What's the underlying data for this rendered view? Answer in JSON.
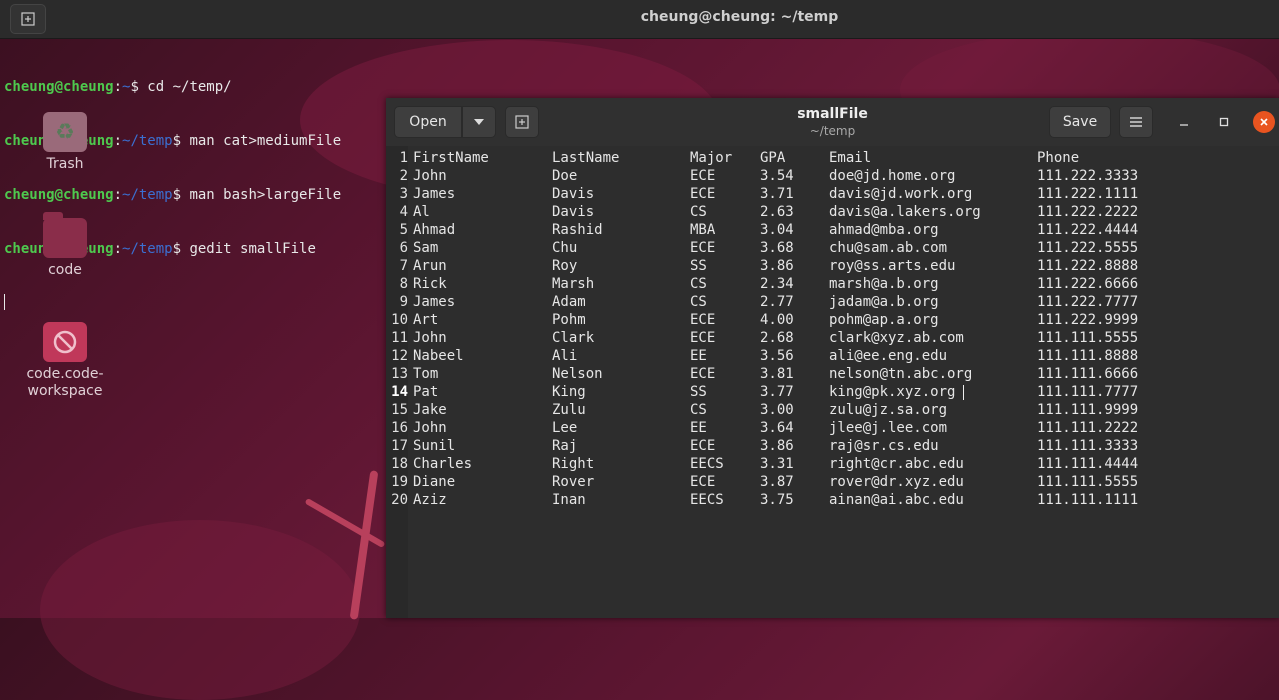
{
  "terminal": {
    "title": "cheung@cheung: ~/temp",
    "lines": [
      {
        "user": "cheung@cheung",
        "sep": ":",
        "path": "~",
        "cmd": "$ cd ~/temp/"
      },
      {
        "user": "cheung@cheung",
        "sep": ":",
        "path": "~/temp",
        "cmd": "$ man cat>mediumFile"
      },
      {
        "user": "cheung@cheung",
        "sep": ":",
        "path": "~/temp",
        "cmd": "$ man bash>largeFile"
      },
      {
        "user": "cheung@cheung",
        "sep": ":",
        "path": "~/temp",
        "cmd": "$ gedit smallFile"
      }
    ]
  },
  "desktop": {
    "icons": [
      {
        "label": "Trash",
        "icon": "trash-icon"
      },
      {
        "label": "code",
        "icon": "folder-icon"
      },
      {
        "label": "code.code-workspace",
        "icon": "blocked-file-icon"
      }
    ]
  },
  "gedit": {
    "open_label": "Open",
    "save_label": "Save",
    "title": "smallFile",
    "subtitle": "~/temp",
    "current_line": 14,
    "rows": [
      [
        "1",
        "FirstName",
        "LastName",
        "Major",
        "GPA",
        "Email",
        "Phone"
      ],
      [
        "2",
        "John",
        "Doe",
        "ECE",
        "3.54",
        "doe@jd.home.org",
        "111.222.3333"
      ],
      [
        "3",
        "James",
        "Davis",
        "ECE",
        "3.71",
        "davis@jd.work.org",
        "111.222.1111"
      ],
      [
        "4",
        "Al",
        "Davis",
        "CS",
        "2.63",
        "davis@a.lakers.org",
        "111.222.2222"
      ],
      [
        "5",
        "Ahmad",
        "Rashid",
        "MBA",
        "3.04",
        "ahmad@mba.org",
        "111.222.4444"
      ],
      [
        "6",
        "Sam",
        "Chu",
        "ECE",
        "3.68",
        "chu@sam.ab.com",
        "111.222.5555"
      ],
      [
        "7",
        "Arun",
        "Roy",
        "SS",
        "3.86",
        "roy@ss.arts.edu",
        "111.222.8888"
      ],
      [
        "8",
        "Rick",
        "Marsh",
        "CS",
        "2.34",
        "marsh@a.b.org",
        "111.222.6666"
      ],
      [
        "9",
        "James",
        "Adam",
        "CS",
        "2.77",
        "jadam@a.b.org",
        "111.222.7777"
      ],
      [
        "10",
        "Art",
        "Pohm",
        "ECE",
        "4.00",
        "pohm@ap.a.org",
        "111.222.9999"
      ],
      [
        "11",
        "John",
        "Clark",
        "ECE",
        "2.68",
        "clark@xyz.ab.com",
        "111.111.5555"
      ],
      [
        "12",
        "Nabeel",
        "Ali",
        "EE",
        "3.56",
        "ali@ee.eng.edu",
        "111.111.8888"
      ],
      [
        "13",
        "Tom",
        "Nelson",
        "ECE",
        "3.81",
        "nelson@tn.abc.org",
        "111.111.6666"
      ],
      [
        "14",
        "Pat",
        "King",
        "SS",
        "3.77",
        "king@pk.xyz.org",
        "111.111.7777"
      ],
      [
        "15",
        "Jake",
        "Zulu",
        "CS",
        "3.00",
        "zulu@jz.sa.org",
        "111.111.9999"
      ],
      [
        "16",
        "John",
        "Lee",
        "EE",
        "3.64",
        "jlee@j.lee.com",
        "111.111.2222"
      ],
      [
        "17",
        "Sunil",
        "Raj",
        "ECE",
        "3.86",
        "raj@sr.cs.edu",
        "111.111.3333"
      ],
      [
        "18",
        "Charles",
        "Right",
        "EECS",
        "3.31",
        "right@cr.abc.edu",
        "111.111.4444"
      ],
      [
        "19",
        "Diane",
        "Rover",
        "ECE",
        "3.87",
        "rover@dr.xyz.edu",
        "111.111.5555"
      ],
      [
        "20",
        "Aziz",
        "Inan",
        "EECS",
        "3.75",
        "ainan@ai.abc.edu",
        "111.111.1111"
      ]
    ]
  }
}
